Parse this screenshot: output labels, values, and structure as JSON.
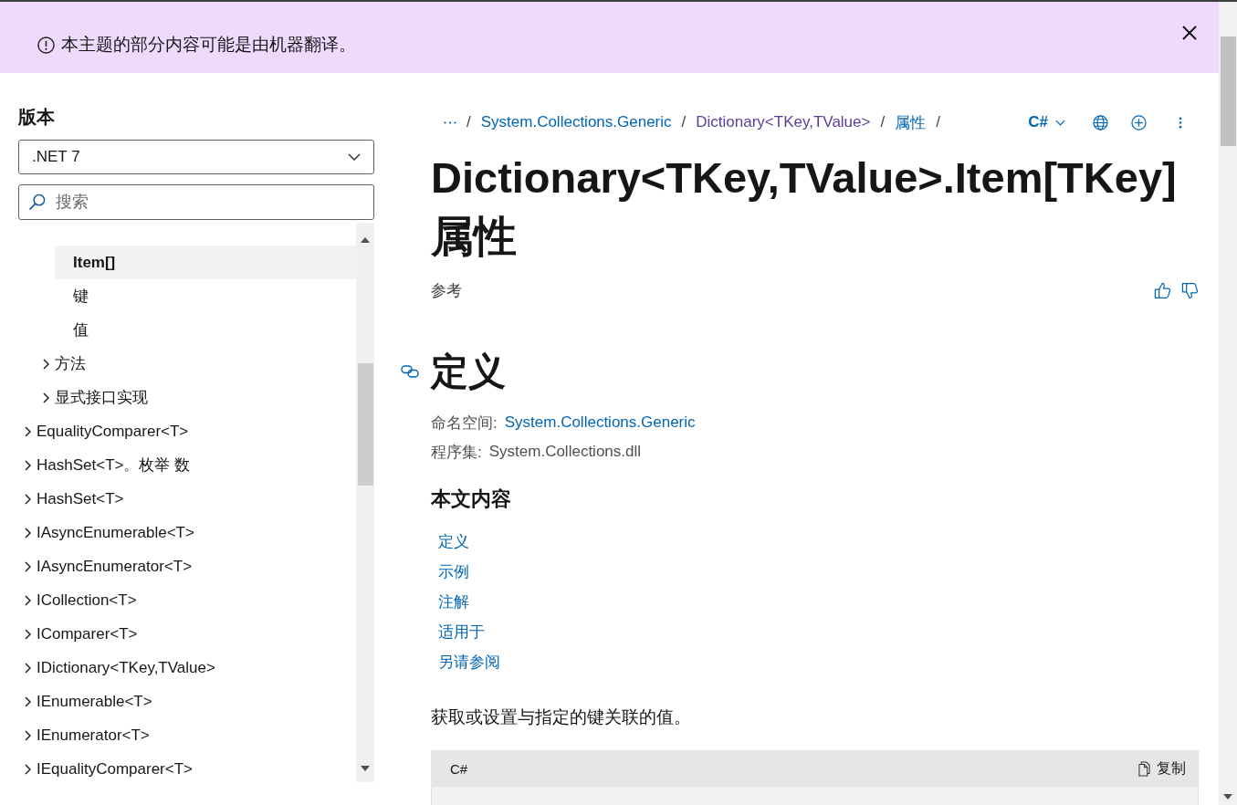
{
  "banner": {
    "message": "本主题的部分内容可能是由机器翻译。"
  },
  "sidebar": {
    "version_label": "版本",
    "version_select": {
      "value": ".NET 7"
    },
    "search": {
      "placeholder": "搜索"
    },
    "toc": [
      {
        "children": [
          {
            "children": [
              {
                "label": "Item[]",
                "selected": true
              },
              {
                "label": "键",
                "selected": false
              },
              {
                "label": "值",
                "selected": false
              }
            ]
          },
          {
            "label": "方法",
            "expanded": false,
            "selected": false
          },
          {
            "label": "显式接口实现",
            "expanded": false,
            "selected": false
          }
        ]
      },
      {
        "label": "EqualityComparer<T>",
        "expanded": false,
        "selected": false
      },
      {
        "label": "HashSet<T>。枚举 数",
        "expanded": false,
        "selected": false
      },
      {
        "label": "HashSet<T>",
        "expanded": false,
        "selected": false
      },
      {
        "label": "IAsyncEnumerable<T>",
        "expanded": false,
        "selected": false
      },
      {
        "label": "IAsyncEnumerator<T>",
        "expanded": false,
        "selected": false
      },
      {
        "label": "ICollection<T>",
        "expanded": false,
        "selected": false
      },
      {
        "label": "IComparer<T>",
        "expanded": false,
        "selected": false
      },
      {
        "label": "IDictionary<TKey,TValue>",
        "expanded": false,
        "selected": false
      },
      {
        "label": "IEnumerable<T>",
        "expanded": false,
        "selected": false
      },
      {
        "label": "IEnumerator<T>",
        "expanded": false,
        "selected": false
      },
      {
        "label": "IEqualityComparer<T>",
        "expanded": false,
        "selected": false
      }
    ]
  },
  "breadcrumbs": {
    "items": [
      {
        "kind": "more",
        "separator": "/"
      },
      {
        "kind": "link",
        "label": "System.Collections.Generic",
        "visited": false,
        "separator": "/"
      },
      {
        "kind": "link",
        "label": "Dictionary<TKey,TValue>",
        "visited": true,
        "separator": "/"
      },
      {
        "kind": "link",
        "label": "属性",
        "visited": false,
        "separator": "/"
      }
    ]
  },
  "toolbar": {
    "language": "C#"
  },
  "title": "Dictionary<TKey,TValue>.Item[TKey] 属性",
  "page_type": "参考",
  "definition": {
    "heading": "定义",
    "namespace": {
      "label": "命名空间:",
      "value": "System.Collections.Generic"
    },
    "assembly": {
      "label": "程序集:",
      "value": "System.Collections.dll"
    }
  },
  "in_this_article": {
    "heading": "本文内容",
    "links": [
      "定义",
      "示例",
      "注解",
      "适用于",
      "另请参阅"
    ]
  },
  "summary": "获取或设置与指定的键关联的值。",
  "code_block": {
    "language": "C#",
    "copy_label": "复制"
  }
}
